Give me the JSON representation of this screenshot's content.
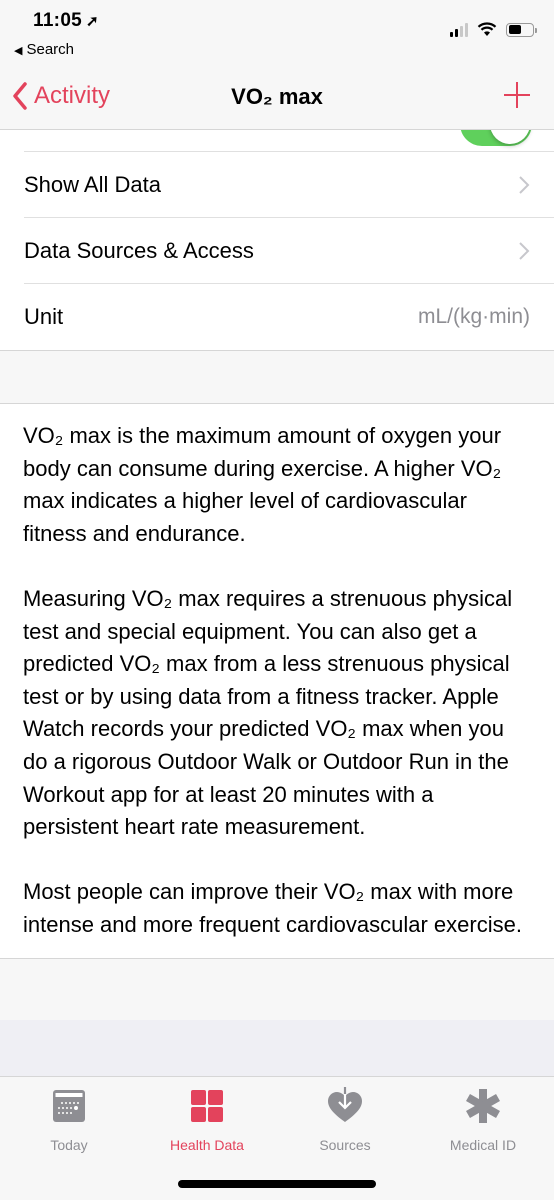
{
  "status_bar": {
    "time": "11:05",
    "back_app": "Search"
  },
  "nav": {
    "back_label": "Activity",
    "title": "VO₂ max",
    "add_icon": "plus-icon"
  },
  "settings": {
    "toggle_on": true,
    "rows": [
      {
        "label": "Show All Data",
        "accessory": "chevron"
      },
      {
        "label": "Data Sources & Access",
        "accessory": "chevron"
      },
      {
        "label": "Unit",
        "value": "mL/(kg·min)"
      }
    ]
  },
  "description": {
    "paragraphs": [
      "VO₂ max is the maximum amount of oxygen your body can consume during exercise. A higher VO₂ max indicates a higher level of cardiovascular fitness and endurance.",
      "Measuring VO₂ max requires a strenuous physical test and special equipment. You can also get a predicted VO₂ max from a less strenuous physical test or by using data from a fitness tracker. Apple Watch records your predicted VO₂ max when you do a rigorous Outdoor Walk or Outdoor Run in the Workout app for at least 20 minutes with a persistent heart rate measurement.",
      "Most people can improve their VO₂ max with more intense and more frequent cardiovascular exercise."
    ]
  },
  "tab_bar": {
    "tabs": [
      {
        "label": "Today",
        "icon": "calendar-icon",
        "active": false
      },
      {
        "label": "Health Data",
        "icon": "grid-icon",
        "active": true
      },
      {
        "label": "Sources",
        "icon": "heart-download-icon",
        "active": false
      },
      {
        "label": "Medical ID",
        "icon": "asterisk-icon",
        "active": false
      }
    ]
  },
  "colors": {
    "accent": "#e3435c",
    "toggle_on": "#5fd05c",
    "secondary_text": "#8e8e93"
  }
}
